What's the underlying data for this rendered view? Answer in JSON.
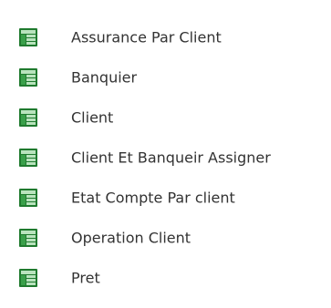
{
  "colors": {
    "text": "#333333",
    "icon_dark": "#1f7a2e",
    "icon_mid": "#3aa04a",
    "icon_light": "#b9e3bd"
  },
  "items": [
    {
      "label": "Assurance Par Client",
      "icon": "table-icon"
    },
    {
      "label": "Banquier",
      "icon": "table-icon"
    },
    {
      "label": "Client",
      "icon": "table-icon"
    },
    {
      "label": "Client Et Banqueir Assigner",
      "icon": "table-icon"
    },
    {
      "label": "Etat Compte Par client",
      "icon": "table-icon"
    },
    {
      "label": "Operation Client",
      "icon": "table-icon"
    },
    {
      "label": "Pret",
      "icon": "table-icon"
    }
  ]
}
